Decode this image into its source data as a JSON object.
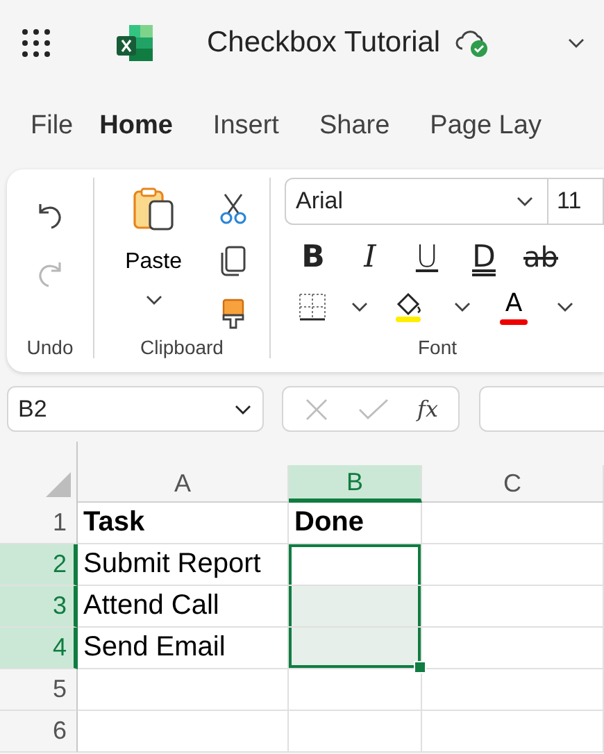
{
  "app_bar": {
    "title": "Checkbox Tutorial"
  },
  "tabs": [
    {
      "label": "File",
      "selected": false
    },
    {
      "label": "Home",
      "selected": true
    },
    {
      "label": "Insert",
      "selected": false
    },
    {
      "label": "Share",
      "selected": false
    },
    {
      "label": "Page Lay",
      "selected": false
    }
  ],
  "ribbon": {
    "undo_group": {
      "label": "Undo",
      "buttons": [
        {
          "kind": "undo",
          "disabled": false
        },
        {
          "kind": "redo",
          "disabled": true
        }
      ]
    },
    "clipboard_group": {
      "label": "Clipboard",
      "paste_label": "Paste"
    },
    "font_group": {
      "label": "Font",
      "font_name": "Arial",
      "font_size": "11",
      "format_buttons": [
        {
          "kind": "bold",
          "label": "B"
        },
        {
          "kind": "italic",
          "label": "I"
        },
        {
          "kind": "underline",
          "label": "U"
        },
        {
          "kind": "double_underline",
          "label": "D"
        },
        {
          "kind": "strikethrough",
          "label": "ab"
        }
      ],
      "font_color_label": "A"
    }
  },
  "formula_bar": {
    "name_box": "B2",
    "function_label": "fx"
  },
  "sheet": {
    "columns": [
      {
        "label": "A",
        "selected": false
      },
      {
        "label": "B",
        "selected": true
      },
      {
        "label": "C",
        "selected": false
      }
    ],
    "rows": [
      {
        "number": "1",
        "selected": false,
        "cells": [
          {
            "value": "Task",
            "bold": true,
            "selected": false,
            "active": false
          },
          {
            "value": "Done",
            "bold": true,
            "selected": false,
            "active": false
          },
          {
            "selected": false,
            "active": false
          }
        ]
      },
      {
        "number": "2",
        "selected": true,
        "cells": [
          {
            "value": "Submit Report",
            "bold": false,
            "selected": false,
            "active": false
          },
          {
            "selected": true,
            "active": true
          },
          {
            "selected": false,
            "active": false
          }
        ]
      },
      {
        "number": "3",
        "selected": true,
        "cells": [
          {
            "value": "Attend Call",
            "bold": false,
            "selected": false,
            "active": false
          },
          {
            "selected": true,
            "active": false
          },
          {
            "selected": false,
            "active": false
          }
        ]
      },
      {
        "number": "4",
        "selected": true,
        "cells": [
          {
            "value": "Send Email",
            "bold": false,
            "selected": false,
            "active": false
          },
          {
            "selected": true,
            "active": false
          },
          {
            "selected": false,
            "active": false
          }
        ]
      },
      {
        "number": "5",
        "selected": false,
        "cells": [
          {
            "selected": false,
            "active": false
          },
          {
            "selected": false,
            "active": false
          },
          {
            "selected": false,
            "active": false
          }
        ]
      },
      {
        "number": "6",
        "selected": false,
        "cells": [
          {
            "selected": false,
            "active": false
          },
          {
            "selected": false,
            "active": false
          },
          {
            "selected": false,
            "active": false
          }
        ]
      }
    ]
  }
}
